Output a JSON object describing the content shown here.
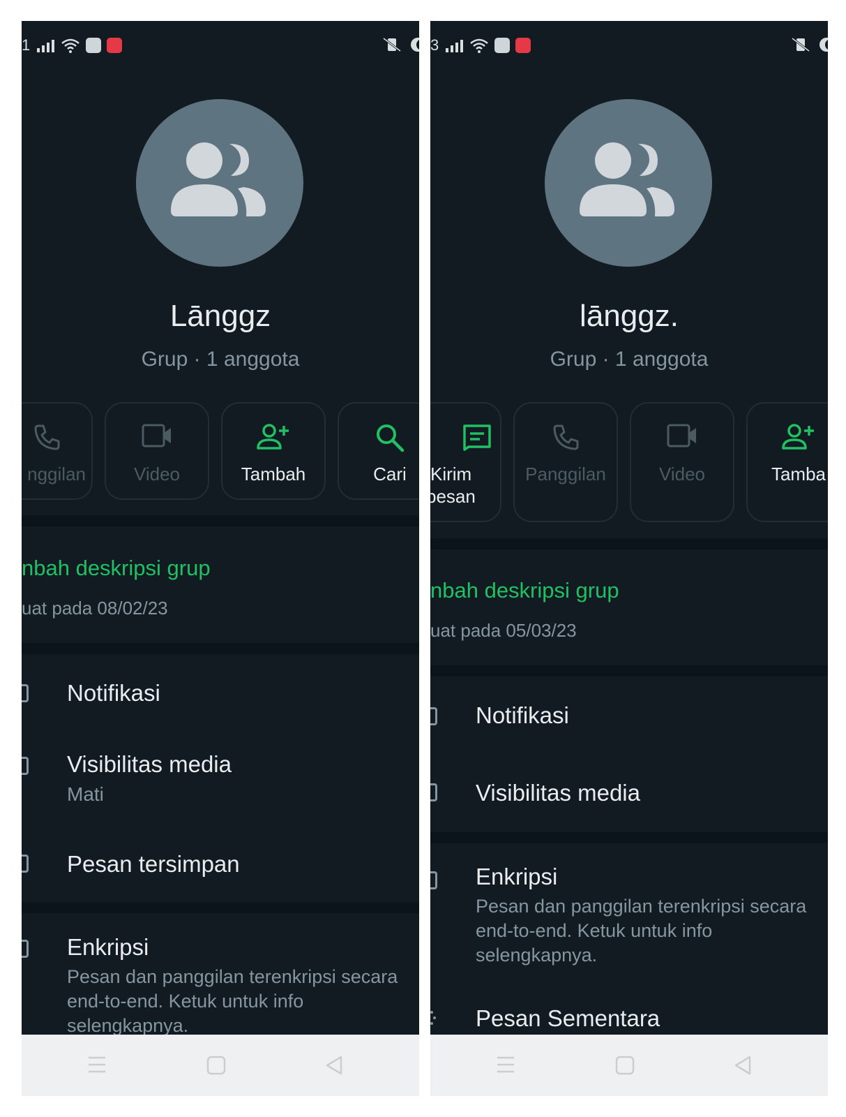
{
  "colors": {
    "background": "#111b21",
    "accent": "#21c063",
    "muted": "#8696a0",
    "avatar": "#5e7480"
  },
  "left": {
    "status": {
      "left_text": "1"
    },
    "group": {
      "name": "Lānggz",
      "subtitle": "Grup · 1 anggota"
    },
    "actions": [
      {
        "label": "nggilan",
        "icon": "phone-icon"
      },
      {
        "label": "Video",
        "icon": "video-icon"
      },
      {
        "label": "Tambah",
        "icon": "add-person-icon"
      },
      {
        "label": "Cari",
        "icon": "search-icon"
      }
    ],
    "description": {
      "link": "nbah deskripsi grup",
      "date": "uat pada 08/02/23"
    },
    "settings": {
      "notifikasi": "Notifikasi",
      "visibilitas": "Visibilitas media",
      "visibilitas_value": "Mati",
      "pesan_tersimpan": "Pesan tersimpan",
      "enkripsi": "Enkripsi",
      "enkripsi_desc": "Pesan dan panggilan terenkripsi secara end-to-end. Ketuk untuk info selengkapnya."
    }
  },
  "right": {
    "status": {
      "left_text": "3"
    },
    "group": {
      "name": "lānggz.",
      "subtitle": "Grup · 1 anggota"
    },
    "actions": [
      {
        "label_line1": "Kirim",
        "label_line2": "pesan",
        "icon": "message-icon"
      },
      {
        "label": "Panggilan",
        "icon": "phone-icon"
      },
      {
        "label": "Video",
        "icon": "video-icon"
      },
      {
        "label": "Tamba",
        "icon": "add-person-icon"
      }
    ],
    "description": {
      "link": "nbah deskripsi grup",
      "date": "uat pada 05/03/23"
    },
    "settings": {
      "notifikasi": "Notifikasi",
      "visibilitas": "Visibilitas media",
      "enkripsi": "Enkripsi",
      "enkripsi_desc": "Pesan dan panggilan terenkripsi secara end-to-end. Ketuk untuk info selengkapnya.",
      "pesan_sementara": "Pesan Sementara"
    }
  }
}
